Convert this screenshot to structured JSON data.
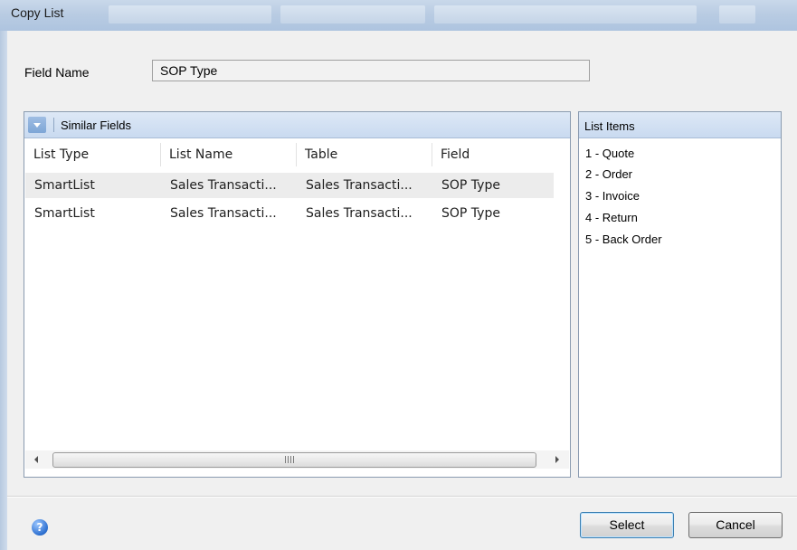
{
  "window": {
    "title": "Copy List"
  },
  "field": {
    "label": "Field Name",
    "value": "SOP Type"
  },
  "similar_fields": {
    "title": "Similar Fields",
    "columns": [
      "List Type",
      "List Name",
      "Table",
      "Field"
    ],
    "rows": [
      [
        "SmartList",
        "Sales Transacti...",
        "Sales Transacti...",
        "SOP Type"
      ],
      [
        "SmartList",
        "Sales Transacti...",
        "Sales Transacti...",
        "SOP Type"
      ]
    ],
    "scroll_grip": "III"
  },
  "list_items": {
    "title": "List Items",
    "items": [
      "1 - Quote",
      "2 - Order",
      "3 - Invoice",
      "4 - Return",
      "5 - Back Order"
    ]
  },
  "footer": {
    "help_icon": "?",
    "select_label": "Select",
    "cancel_label": "Cancel"
  },
  "colors": {
    "header_blue": "#c9daf0",
    "selected_row": "#ececec"
  }
}
